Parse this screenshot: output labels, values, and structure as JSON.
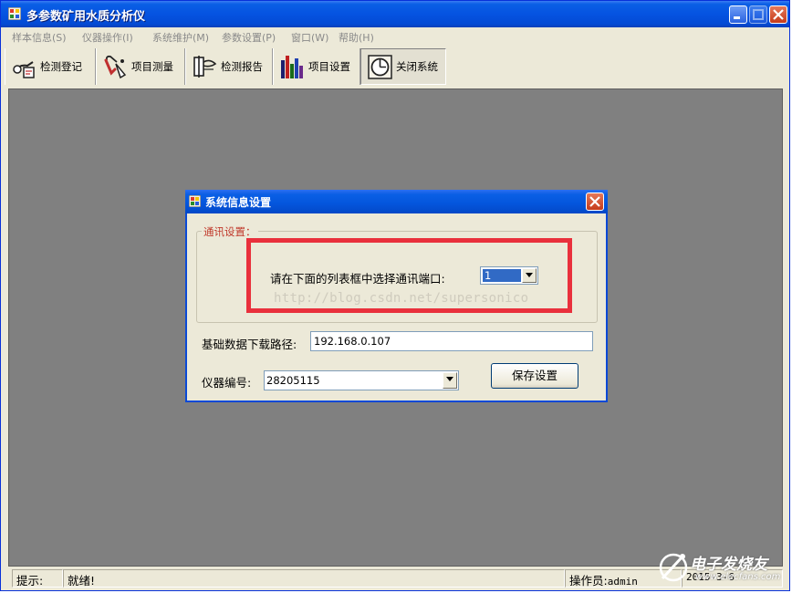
{
  "window": {
    "title": "多参数矿用水质分析仪"
  },
  "menu": [
    {
      "label": "样本信息(S)"
    },
    {
      "label": "仪器操作(I)"
    },
    {
      "label": "系统维护(M)"
    },
    {
      "label": "参数设置(P)"
    },
    {
      "label": "窗口(W)"
    },
    {
      "label": "帮助(H)"
    }
  ],
  "toolbar": [
    {
      "label": "检测登记",
      "icon": "register-icon"
    },
    {
      "label": "项目测量",
      "icon": "measure-icon"
    },
    {
      "label": "检测报告",
      "icon": "report-icon"
    },
    {
      "label": "项目设置",
      "icon": "settings-bars-icon"
    },
    {
      "label": "关闭系统",
      "icon": "shutdown-icon"
    }
  ],
  "dialog": {
    "title": "系统信息设置",
    "group_label": "通讯设置：",
    "port_label": "请在下面的列表框中选择通讯端口:",
    "port_value": "1",
    "watermark": "http://blog.csdn.net/supersonico",
    "path_label": "基础数据下载路径:",
    "path_value": "192.168.0.107",
    "device_label": "仪器编号:",
    "device_value": "28205115",
    "save_label": "保存设置"
  },
  "status": {
    "hint_label": "提示:",
    "hint_value": "就绪!",
    "operator_label": "操作员:",
    "operator_value": "admin",
    "date_value": "2015-3-6"
  },
  "logo": {
    "name": "电子发烧友",
    "url": "www.elecfans.com"
  },
  "colors": {
    "titlebar": "#0553e1",
    "highlight": "#e9303c",
    "mdi_background": "#808080"
  }
}
